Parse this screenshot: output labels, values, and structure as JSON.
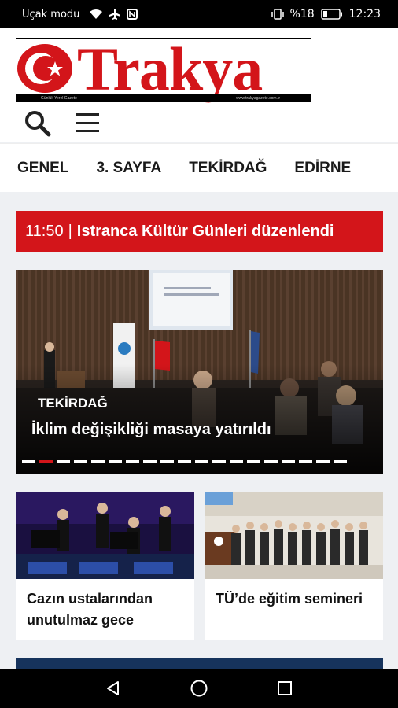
{
  "status_bar": {
    "carrier": "Uçak modu",
    "battery": "%18",
    "time": "12:23"
  },
  "header": {
    "logo_text": "Trakya",
    "logo_tagline": "Günlük Yerel Gazete",
    "logo_website": "www.trakyagazete.com.tr"
  },
  "nav": {
    "items": [
      {
        "label": "GENEL"
      },
      {
        "label": "3. SAYFA"
      },
      {
        "label": "TEKİRDAĞ"
      },
      {
        "label": "EDİRNE"
      }
    ]
  },
  "ticker": {
    "time": "11:50",
    "separator": "|",
    "title": "Istranca Kültür Günleri düzenlendi"
  },
  "hero": {
    "category": "TEKİRDAĞ",
    "title": "İklim değişikliği masaya yatırıldı",
    "slide_count": 19,
    "active_slide": 2
  },
  "cards": [
    {
      "title": "Cazın ustalarından unutulmaz gece"
    },
    {
      "title": "TÜ’de eğitim semineri"
    }
  ],
  "colors": {
    "brand_red": "#d3151a",
    "status_bar": "#000000",
    "page_bg": "#eef0f3"
  }
}
